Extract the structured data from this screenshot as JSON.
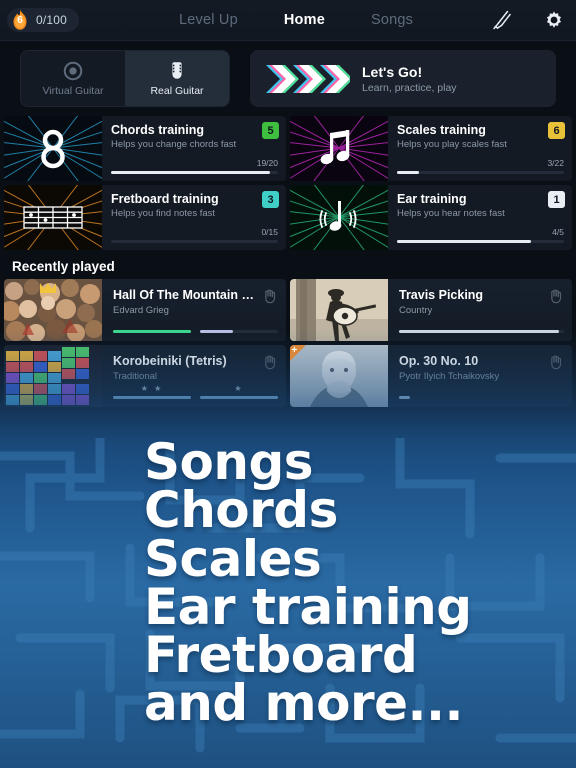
{
  "header": {
    "streak": {
      "level": "6",
      "count": "0/100",
      "icon": "flame-icon"
    },
    "nav": [
      {
        "label": "Level Up",
        "active": false
      },
      {
        "label": "Home",
        "active": true
      },
      {
        "label": "Songs",
        "active": false
      }
    ],
    "icons": [
      {
        "name": "tuning-fork-icon"
      },
      {
        "name": "gear-icon"
      }
    ]
  },
  "mode_toggle": {
    "options": [
      {
        "label": "Virtual Guitar",
        "icon": "target-circle-icon",
        "active": false
      },
      {
        "label": "Real Guitar",
        "icon": "guitar-headstock-icon",
        "active": true
      }
    ]
  },
  "lets_go": {
    "title": "Let's Go!",
    "subtitle": "Learn, practice, play",
    "icon": "triple-chevron-icon",
    "chevron_colors": [
      "#59e3a7",
      "#ffffff",
      "#e86fd0"
    ]
  },
  "training": [
    {
      "title": "Chords training",
      "subtitle": "Helps you change chords fast",
      "badge": "5",
      "badge_color": "#3fbf3f",
      "progress_text": "19/20",
      "progress_pct": 95,
      "art": "chord-diagram-blue",
      "ray_color": "#2aa7d8"
    },
    {
      "title": "Scales training",
      "subtitle": "Helps you play scales fast",
      "badge": "6",
      "badge_color": "#e8c33a",
      "progress_text": "3/22",
      "progress_pct": 13,
      "art": "beamed-notes-magenta",
      "ray_color": "#c02bbf"
    },
    {
      "title": "Fretboard training",
      "subtitle": "Helps you find notes fast",
      "badge": "3",
      "badge_color": "#3fcfc6",
      "progress_text": "0/15",
      "progress_pct": 0,
      "art": "fretboard-orange",
      "ray_color": "#d98628"
    },
    {
      "title": "Ear training",
      "subtitle": "Helps you hear notes fast",
      "badge": "1",
      "badge_color": "#e9eef4",
      "progress_text": "4/5",
      "progress_pct": 80,
      "art": "sounding-note-green",
      "ray_color": "#2bb77e"
    }
  ],
  "recent": {
    "heading": "Recently played",
    "items": [
      {
        "title": "Hall Of The Mountain King",
        "artist": "Edvard Grieg",
        "art": "crowd-painting",
        "premium": false,
        "bar_left_pct": 100,
        "bar_left_color": "#3bd68f",
        "bar_right_pct": 42,
        "bar_right_color": "#b9c0e4",
        "stars": ""
      },
      {
        "title": "Travis Picking",
        "artist": "Country",
        "art": "guitarist-sepia",
        "premium": false,
        "bar_left_pct": 100,
        "bar_left_color": "#cdd6e4",
        "bar_right_pct": 100,
        "bar_right_color": "#cdd6e4",
        "stars": ""
      },
      {
        "title": "Korobeiniki (Tetris)",
        "artist": "Traditional",
        "art": "tetris-blocks",
        "premium": false,
        "bar_left_pct": 100,
        "bar_left_color": "#7fb6d8",
        "bar_right_pct": 100,
        "bar_right_color": "#7fb6d8",
        "stars": "★ ★"
      },
      {
        "title": "Op. 30 No. 10",
        "artist": "Pyotr Ilyich Tchaikovsky",
        "art": "tchaikovsky-portrait",
        "premium": true,
        "premium_glyph": "+",
        "bar_left_pct": 14,
        "bar_left_color": "#9fc4de",
        "bar_right_pct": 0,
        "bar_right_color": "#9fc4de",
        "stars": ""
      }
    ]
  },
  "promo": {
    "lines": [
      "Songs",
      "Chords",
      "Scales",
      "Ear training",
      "Fretboard",
      "and more..."
    ],
    "bg_color": "#2a6aa4"
  }
}
